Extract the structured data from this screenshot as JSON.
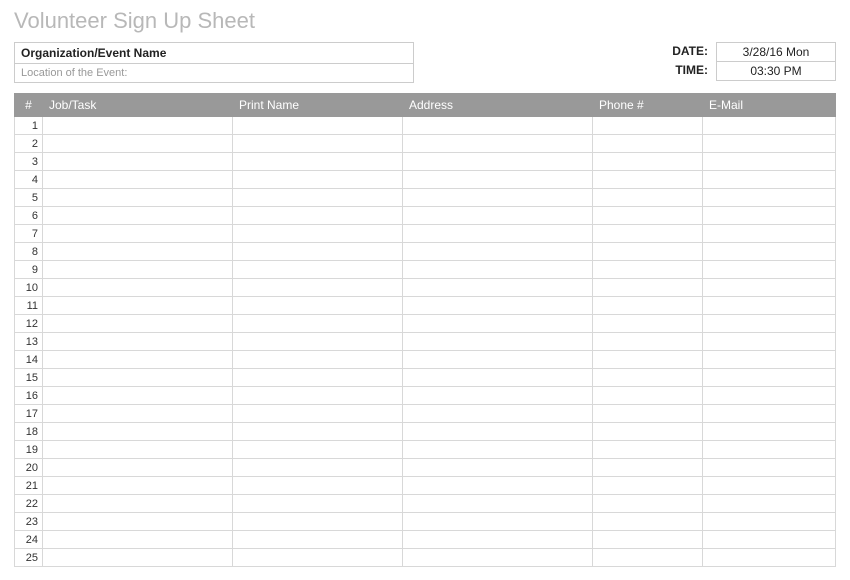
{
  "title": "Volunteer Sign Up Sheet",
  "org_label": "Organization/Event Name",
  "location_label": "Location of the Event:",
  "date_label": "DATE:",
  "date_value": "3/28/16 Mon",
  "time_label": "TIME:",
  "time_value": "03:30 PM",
  "columns": {
    "num": "#",
    "job": "Job/Task",
    "name": "Print Name",
    "address": "Address",
    "phone": "Phone #",
    "email": "E-Mail"
  },
  "rows": [
    {
      "n": "1",
      "job": "",
      "name": "",
      "address": "",
      "phone": "",
      "email": ""
    },
    {
      "n": "2",
      "job": "",
      "name": "",
      "address": "",
      "phone": "",
      "email": ""
    },
    {
      "n": "3",
      "job": "",
      "name": "",
      "address": "",
      "phone": "",
      "email": ""
    },
    {
      "n": "4",
      "job": "",
      "name": "",
      "address": "",
      "phone": "",
      "email": ""
    },
    {
      "n": "5",
      "job": "",
      "name": "",
      "address": "",
      "phone": "",
      "email": ""
    },
    {
      "n": "6",
      "job": "",
      "name": "",
      "address": "",
      "phone": "",
      "email": ""
    },
    {
      "n": "7",
      "job": "",
      "name": "",
      "address": "",
      "phone": "",
      "email": ""
    },
    {
      "n": "8",
      "job": "",
      "name": "",
      "address": "",
      "phone": "",
      "email": ""
    },
    {
      "n": "9",
      "job": "",
      "name": "",
      "address": "",
      "phone": "",
      "email": ""
    },
    {
      "n": "10",
      "job": "",
      "name": "",
      "address": "",
      "phone": "",
      "email": ""
    },
    {
      "n": "11",
      "job": "",
      "name": "",
      "address": "",
      "phone": "",
      "email": ""
    },
    {
      "n": "12",
      "job": "",
      "name": "",
      "address": "",
      "phone": "",
      "email": ""
    },
    {
      "n": "13",
      "job": "",
      "name": "",
      "address": "",
      "phone": "",
      "email": ""
    },
    {
      "n": "14",
      "job": "",
      "name": "",
      "address": "",
      "phone": "",
      "email": ""
    },
    {
      "n": "15",
      "job": "",
      "name": "",
      "address": "",
      "phone": "",
      "email": ""
    },
    {
      "n": "16",
      "job": "",
      "name": "",
      "address": "",
      "phone": "",
      "email": ""
    },
    {
      "n": "17",
      "job": "",
      "name": "",
      "address": "",
      "phone": "",
      "email": ""
    },
    {
      "n": "18",
      "job": "",
      "name": "",
      "address": "",
      "phone": "",
      "email": ""
    },
    {
      "n": "19",
      "job": "",
      "name": "",
      "address": "",
      "phone": "",
      "email": ""
    },
    {
      "n": "20",
      "job": "",
      "name": "",
      "address": "",
      "phone": "",
      "email": ""
    },
    {
      "n": "21",
      "job": "",
      "name": "",
      "address": "",
      "phone": "",
      "email": ""
    },
    {
      "n": "22",
      "job": "",
      "name": "",
      "address": "",
      "phone": "",
      "email": ""
    },
    {
      "n": "23",
      "job": "",
      "name": "",
      "address": "",
      "phone": "",
      "email": ""
    },
    {
      "n": "24",
      "job": "",
      "name": "",
      "address": "",
      "phone": "",
      "email": ""
    },
    {
      "n": "25",
      "job": "",
      "name": "",
      "address": "",
      "phone": "",
      "email": ""
    }
  ]
}
